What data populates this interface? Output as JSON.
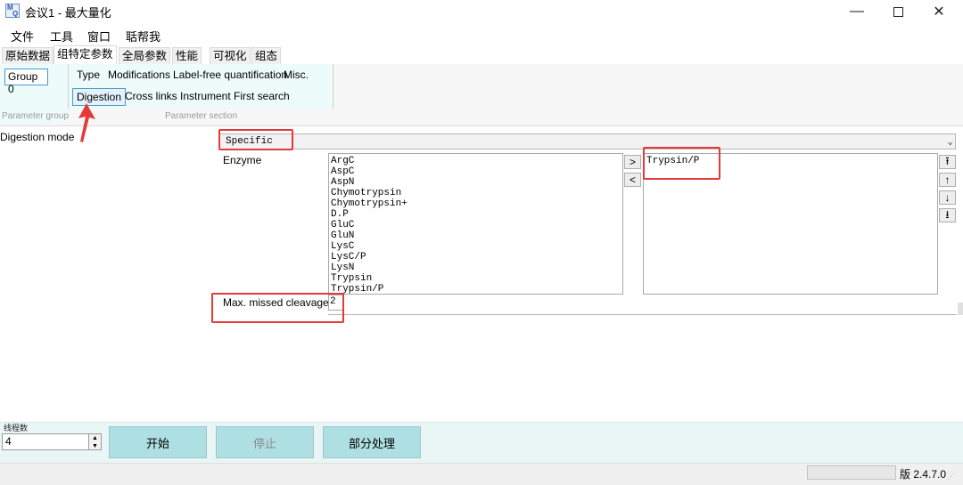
{
  "window": {
    "title": "会议1 - 最大量化",
    "app_icon_text": [
      "M",
      "Q"
    ]
  },
  "menu": [
    "文件",
    "工具",
    "窗口",
    "聒帮我"
  ],
  "tabs": [
    {
      "label": "原始数据",
      "active": false
    },
    {
      "label": "组特定参数",
      "active": true
    },
    {
      "label": "全局参数",
      "active": false
    },
    {
      "label": "性能",
      "active": false
    },
    {
      "label": "可视化",
      "active": false
    },
    {
      "label": "组态",
      "active": false
    }
  ],
  "ribbon": {
    "group_button": "Group 0",
    "parameter_group_label": "Parameter group",
    "parameter_section_label": "Parameter section",
    "sections_row1": [
      "Type",
      "Modifications",
      "Label-free quantification",
      "Misc."
    ],
    "sections_row2": [
      "Digestion",
      "Cross links",
      "Instrument",
      "First search"
    ],
    "active_section": "Digestion"
  },
  "digestion": {
    "mode_label": "Digestion mode",
    "mode_value": "Specific",
    "enzyme_label": "Enzyme",
    "available_enzymes": [
      "ArgC",
      "AspC",
      "AspN",
      "Chymotrypsin",
      "Chymotrypsin+",
      "D.P",
      "GluC",
      "GluN",
      "LysC",
      "LysC/P",
      "LysN",
      "Trypsin",
      "Trypsin/P"
    ],
    "selected_enzymes": [
      "Trypsin/P"
    ],
    "add_symbol": ">",
    "remove_symbol": "<",
    "reorder_symbols": [
      "⭱",
      "↑",
      "↓",
      "⭳"
    ],
    "max_missed_label": "Max. missed cleavages",
    "max_missed_value": "2"
  },
  "bottom": {
    "threads_label": "线程数",
    "threads_value": "4",
    "start_button": "开始",
    "stop_button": "停止",
    "partial_button": "部分处理"
  },
  "status": {
    "version": "版 2.4.7.0"
  },
  "colors": {
    "annotation_red": "#e53a3a",
    "accent_blue": "#4a9ad0",
    "button_teal": "#aedfe2",
    "panel_teal": "#eefbfb"
  }
}
